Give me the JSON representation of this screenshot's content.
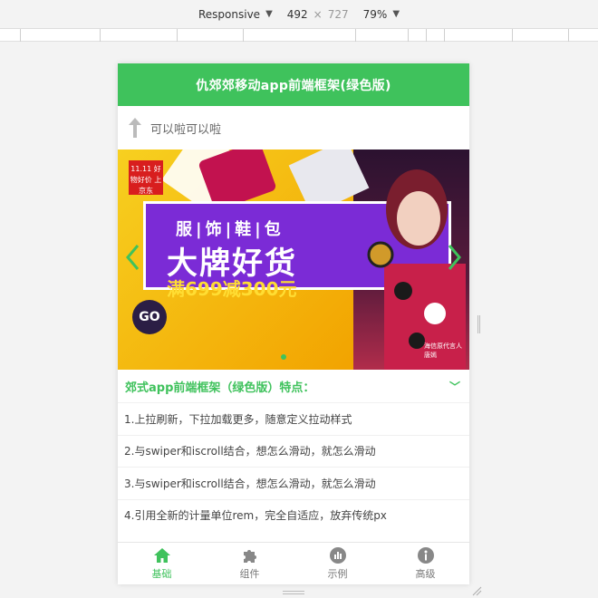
{
  "devtools": {
    "device": "Responsive",
    "width": "492",
    "times": "×",
    "height": "727",
    "zoom": "79%"
  },
  "app": {
    "title": "仇郊郊移动app前端框架(绿色版)",
    "pull_text": "可以啦可以啦"
  },
  "banner": {
    "line1": "服|饰|鞋|包",
    "line2": "大牌好货",
    "line3": "满699减300元",
    "go": "GO",
    "tag": "11.11 好物好价 上京东",
    "caption1": "海信原代言人",
    "caption2": "唐嫣",
    "slides": 3,
    "active_slide": 2
  },
  "features": {
    "heading": "郊式app前端框架（绿色版）特点：",
    "items": [
      "1.上拉刷新，下拉加载更多，随意定义拉动样式",
      "2.与swiper和iscroll结合，想怎么滑动，就怎么滑动",
      "3.与swiper和iscroll结合，想怎么滑动，就怎么滑动",
      "4.引用全新的计量单位rem，完全自适应，放弃传统px"
    ]
  },
  "tabs": [
    {
      "label": "基础",
      "icon": "home-icon",
      "active": true
    },
    {
      "label": "组件",
      "icon": "puzzle-icon",
      "active": false
    },
    {
      "label": "示例",
      "icon": "chart-circle-icon",
      "active": false
    },
    {
      "label": "高级",
      "icon": "info-icon",
      "active": false
    }
  ],
  "colors": {
    "accent": "#3fc25c",
    "banner_purple": "#7b2bd6",
    "banner_yellow": "#f5c400"
  }
}
